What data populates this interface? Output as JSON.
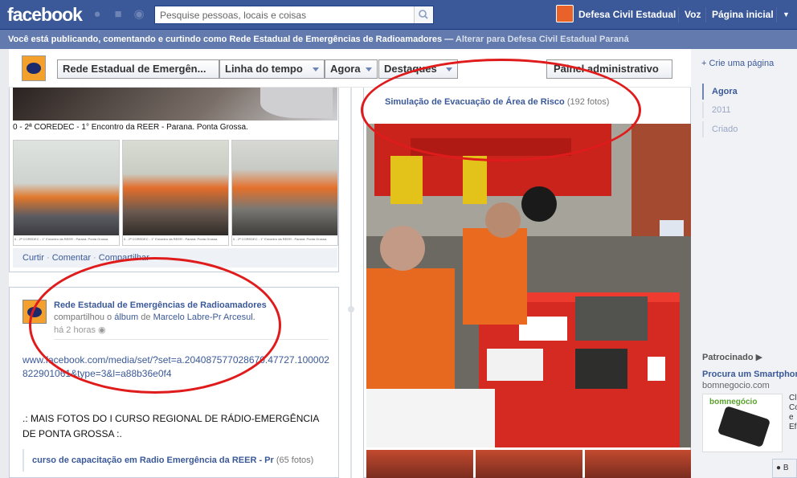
{
  "topbar": {
    "logo": "facebook",
    "search_placeholder": "Pesquise pessoas, locais e coisas",
    "page_name": "Defesa Civil Estadual",
    "voz": "Voz",
    "home": "Página inicial"
  },
  "notice": {
    "text": "Você está publicando, comentando e curtindo como Rede Estadual de Emergências de Radioamadores —",
    "switch_link": "Alterar para Defesa Civil Estadual Paraná"
  },
  "nav": {
    "page_name": "Rede Estadual de Emergên...",
    "timeline": "Linha do tempo",
    "now": "Agora",
    "highlights": "Destaques",
    "admin_panel": "Painel administrativo"
  },
  "post1": {
    "caption": "0 - 2ª COREDEC - 1° Encontro da REER - Parana. Ponta Grossa.",
    "thumb_caption": "0 - 2ª COREDEC - 1° Encontro da REER - Paraná. Ponta Grossa.",
    "actions": [
      "Curtir",
      "Comentar",
      "Compartilhar"
    ]
  },
  "post2": {
    "author": "Rede Estadual de Emergências de Radioamadores",
    "shared_prefix": "compartilhou o",
    "shared_album": "álbum",
    "shared_of": "de",
    "shared_user": "Marcelo Labre-Pr Arcesul.",
    "time": "há 2 horas",
    "url": "www.facebook.com/media/set/?set=a.204087577028670.47727.100002822901061&type=3&l=a88b36e0f4",
    "text": ".: MAIS FOTOS DO I CURSO REGIONAL DE RÁDIO-EMERGÊNCIA DE PONTA GROSSA :.",
    "album_title": "curso de capacitação em Radio Emergência da REER - Pr",
    "album_count": "(65 fotos)"
  },
  "right_post": {
    "album_title": "Simulação de Evacuação de Área de Risco",
    "album_count": "(192 fotos)"
  },
  "rcol": {
    "create_page": "Crie uma página",
    "years": [
      "Agora",
      "2011",
      "Criado"
    ],
    "sponsored": "Patrocinado",
    "ad_title": "Procura um Smartphone",
    "ad_domain": "bomnegocio.com",
    "ad_brand": "bomnegócio",
    "ad_side_text": "Cl Co e Ef",
    "chat": "B"
  },
  "colors": {
    "facebook_blue": "#3b5998",
    "annotation_red": "#e01b1b"
  }
}
